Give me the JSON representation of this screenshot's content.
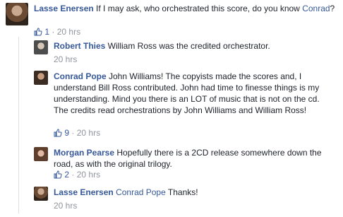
{
  "comments": [
    {
      "name": "Lasse Enersen",
      "text_a": " If I may ask, who orchestrated this score, do you know ",
      "mention": "Conrad",
      "text_b": "?",
      "likes": "1",
      "time": "20 hrs",
      "separator": "·"
    },
    {
      "name": "Robert Thies",
      "text": " William Ross was the credited orchestrator.",
      "time": "20 hrs"
    },
    {
      "name": "Conrad Pope",
      "text": " John Williams! The copyists made the scores and, I understand Bill Ross contributed. John had time to finesse things is my understanding. Mind you there is an LOT of music that is not on the cd. The credits read orchestrations by John Williams and William Ross!",
      "likes": "9",
      "time": "20 hrs",
      "separator": "·"
    },
    {
      "name": "Morgan Pearse",
      "text": " Hopefully there is a 2CD release somewhere down the road, as with the original trilogy.",
      "likes": "2",
      "time": "20 hrs",
      "separator": "·"
    },
    {
      "name": "Lasse Enersen",
      "mention": "Conrad Pope",
      "text": " Thanks!",
      "time": "20 hrs"
    }
  ],
  "colors": {
    "link": "#365899",
    "meta": "#90949c",
    "text": "#1d2129",
    "divider": "#dddfe2"
  },
  "icons": {
    "like": "thumbs-up-icon"
  }
}
